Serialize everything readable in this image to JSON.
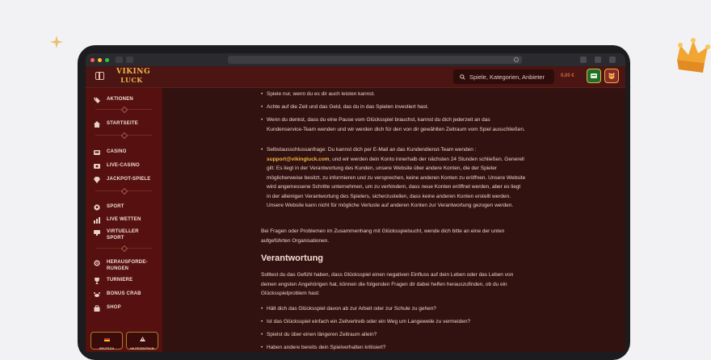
{
  "header": {
    "logo_line1": "VIKING",
    "logo_line2": "LUCK",
    "search_placeholder": "Spiele, Kategorien, Anbieter",
    "balance": "0,00 €"
  },
  "sidebar": {
    "items": [
      {
        "label": "AKTIONEN",
        "icon": "tag-icon"
      },
      {
        "label": "STARTSEITE",
        "icon": "home-icon"
      },
      {
        "label": "CASINO",
        "icon": "slot-icon"
      },
      {
        "label": "LIVE-CASINO",
        "icon": "live-icon"
      },
      {
        "label": "JACKPOT-SPIELE",
        "icon": "jackpot-icon"
      },
      {
        "label": "SPORT",
        "icon": "ball-icon"
      },
      {
        "label": "LIVE WETTEN",
        "icon": "chart-icon"
      },
      {
        "label": "VIRTUELLER SPORT",
        "icon": "virtual-icon"
      },
      {
        "label": "HERAUSFORDE-RUNGEN",
        "icon": "target-icon"
      },
      {
        "label": "TURNIERE",
        "icon": "trophy-icon"
      },
      {
        "label": "BONUS CRAB",
        "icon": "crab-icon"
      },
      {
        "label": "SHOP",
        "icon": "shop-icon"
      }
    ],
    "bottom": [
      {
        "label": "DEUTSCH",
        "icon": "flag-icon"
      },
      {
        "label": "HILFEZENTRUM",
        "icon": "help-icon"
      }
    ]
  },
  "content": {
    "bullets_top": [
      "Spiele nur, wenn du es dir auch leisten kannst.",
      "Achte auf die Zeit und das Geld, das du in das Spielen investiert hast.",
      "Wenn du denkst, dass du eine Pause vom Glücksspiel brauchst, kannst du dich jederzeit an das Kundenservice-Team wenden und wir werden dich für den von dir gewählten Zeitraum vom Spiel ausschließen."
    ],
    "selfex": {
      "before": "Selbstausschlussanfrage: Du kannst dich per E-Mail an das Kundendienst-Team wenden : ",
      "email": "support@vikingluck.com",
      "after": ", und wir werden dein Konto innerhalb der nächsten 24 Stunden schließen. Generell gilt: Es liegt in der Verantwortung des Kunden, unsere Website über andere Konten, die der Spieler möglicherweise besitzt, zu informieren und zu versprechen, keine anderen Konten zu eröffnen. Unsere Website wird angemessene Schritte unternehmen, um zu verhindern, dass neue Konten eröffnet werden, aber es liegt in der alleinigen Verantwortung des Spielers, sicherzustellen, dass keine anderen Konten erstellt werden. Unsere Website kann nicht für mögliche Verluste auf anderen Konten zur Verantwortung gezogen werden."
    },
    "para1": "Bei Fragen oder Problemen im Zusammenhang mit Glücksspielsucht, wende dich bitte an eine der unten aufgeführten Organisationen.",
    "heading": "Verantwortung",
    "para2": "Solltest du das Gefühl haben, dass Glücksspiel einen negativen Einfluss auf dein Leben oder das Leben von deinen engsten Angehörigen hat, können die folgenden Fragen dir dabei helfen herauszufinden, ob du ein Glücksspielproblem hast:",
    "bullets_bottom": [
      "Hält dich das Glücksspiel davon ab zur Arbeit oder zur Schule zu gehen?",
      "Ist das Glücksspiel einfach ein Zeitvertreib oder ein Weg um Langeweile zu vermeiden?",
      "Spielst du über einen längeren Zeitraum allein?",
      "Haben andere bereits dein Spielverhalten kritisiert?"
    ]
  },
  "colors": {
    "sidebar_bg": "#55100f",
    "content_bg": "#321210",
    "header_bg": "#4a1513",
    "accent_gold": "#f0b848"
  }
}
